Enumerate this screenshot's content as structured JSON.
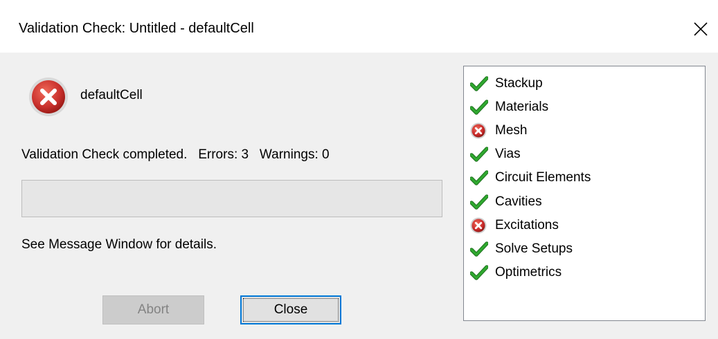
{
  "window": {
    "title": "Validation Check: Untitled - defaultCell"
  },
  "cell": {
    "name": "defaultCell",
    "status_icon": "error-icon"
  },
  "status": {
    "message": "Validation Check completed.   Errors: 3   Warnings: 0",
    "progress_fraction": 0,
    "details": "See Message Window for details."
  },
  "buttons": {
    "abort_label": "Abort",
    "abort_enabled": false,
    "close_label": "Close"
  },
  "checks": [
    {
      "label": "Stackup",
      "status": "pass"
    },
    {
      "label": "Materials",
      "status": "pass"
    },
    {
      "label": "Mesh",
      "status": "error"
    },
    {
      "label": "Vias",
      "status": "pass"
    },
    {
      "label": "Circuit Elements",
      "status": "pass"
    },
    {
      "label": "Cavities",
      "status": "pass"
    },
    {
      "label": "Excitations",
      "status": "error"
    },
    {
      "label": "Solve Setups",
      "status": "pass"
    },
    {
      "label": "Optimetrics",
      "status": "pass"
    }
  ],
  "colors": {
    "pass_green": "#2fa82f",
    "error_red": "#c62828",
    "focus_blue": "#0078d7"
  }
}
